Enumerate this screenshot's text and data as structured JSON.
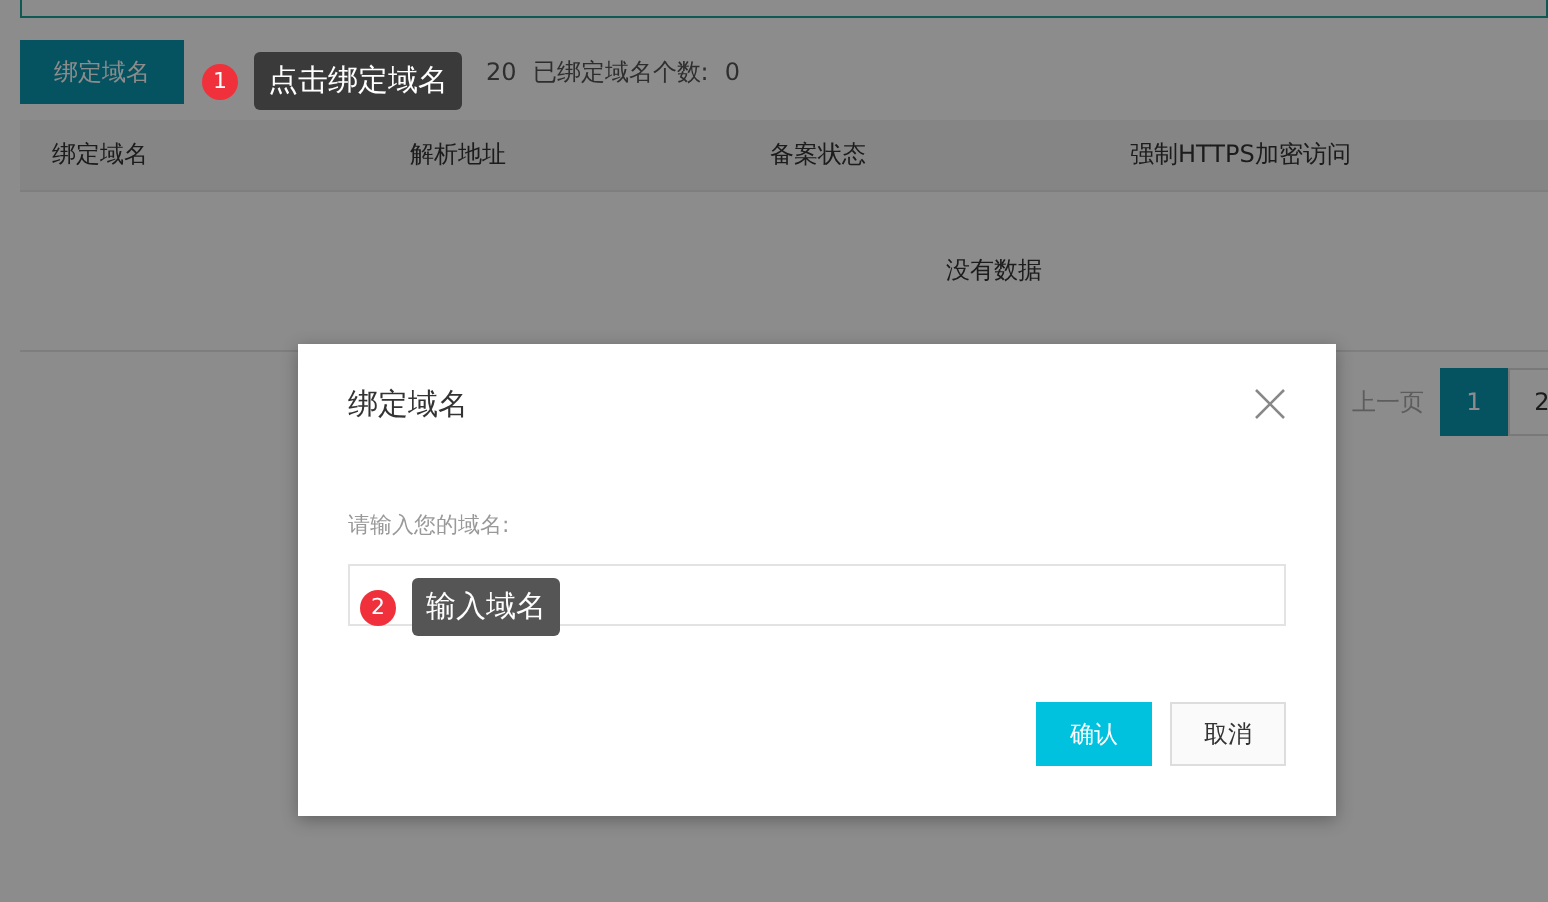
{
  "toolbar": {
    "bind_button": "绑定域名",
    "max_count": "20",
    "bound_label": "已绑定域名个数:",
    "bound_count": "0"
  },
  "table": {
    "columns": [
      "绑定域名",
      "解析地址",
      "备案状态",
      "强制HTTPS加密访问"
    ],
    "empty_text": "没有数据"
  },
  "pagination": {
    "prev": "上一页",
    "pages": [
      {
        "label": "1",
        "selected": true
      },
      {
        "label": "2",
        "selected": false
      }
    ]
  },
  "dialog": {
    "title": "绑定域名",
    "field_label": "请输入您的域名:",
    "buttons": [
      {
        "label": "确认",
        "kind": "primary"
      },
      {
        "label": "取消",
        "kind": "secondary"
      }
    ]
  },
  "hints": [
    {
      "number": "1",
      "text": "点击绑定域名"
    },
    {
      "number": "2",
      "text": "输入域名"
    }
  ]
}
